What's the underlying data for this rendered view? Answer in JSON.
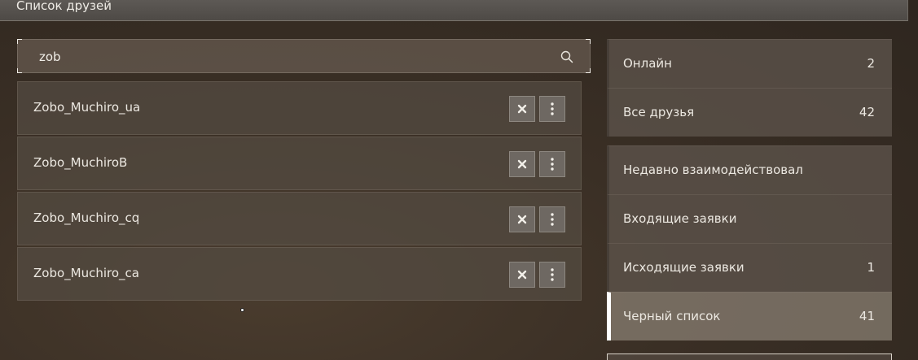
{
  "header": {
    "title": "Список друзей"
  },
  "search": {
    "value": "zob"
  },
  "friends": [
    {
      "name": "Zobo_Muchiro_ua"
    },
    {
      "name": "Zobo_MuchiroB"
    },
    {
      "name": "Zobo_Muchiro_cq"
    },
    {
      "name": "Zobo_Muchiro_ca"
    }
  ],
  "sidebar": {
    "items": [
      {
        "label": "Онлайн",
        "count": "2"
      },
      {
        "label": "Все друзья",
        "count": "42"
      },
      {
        "label": "Недавно взаимодействовал",
        "count": ""
      },
      {
        "label": "Входящие заявки",
        "count": ""
      },
      {
        "label": "Исходящие заявки",
        "count": "1"
      },
      {
        "label": "Черный список",
        "count": "41"
      }
    ],
    "active_index": 5
  },
  "colors": {
    "accent": "#ffffff",
    "button_bg": "#6e6862"
  },
  "icons": {
    "search": "search-icon",
    "remove": "close-icon",
    "menu": "more-vertical-icon"
  }
}
